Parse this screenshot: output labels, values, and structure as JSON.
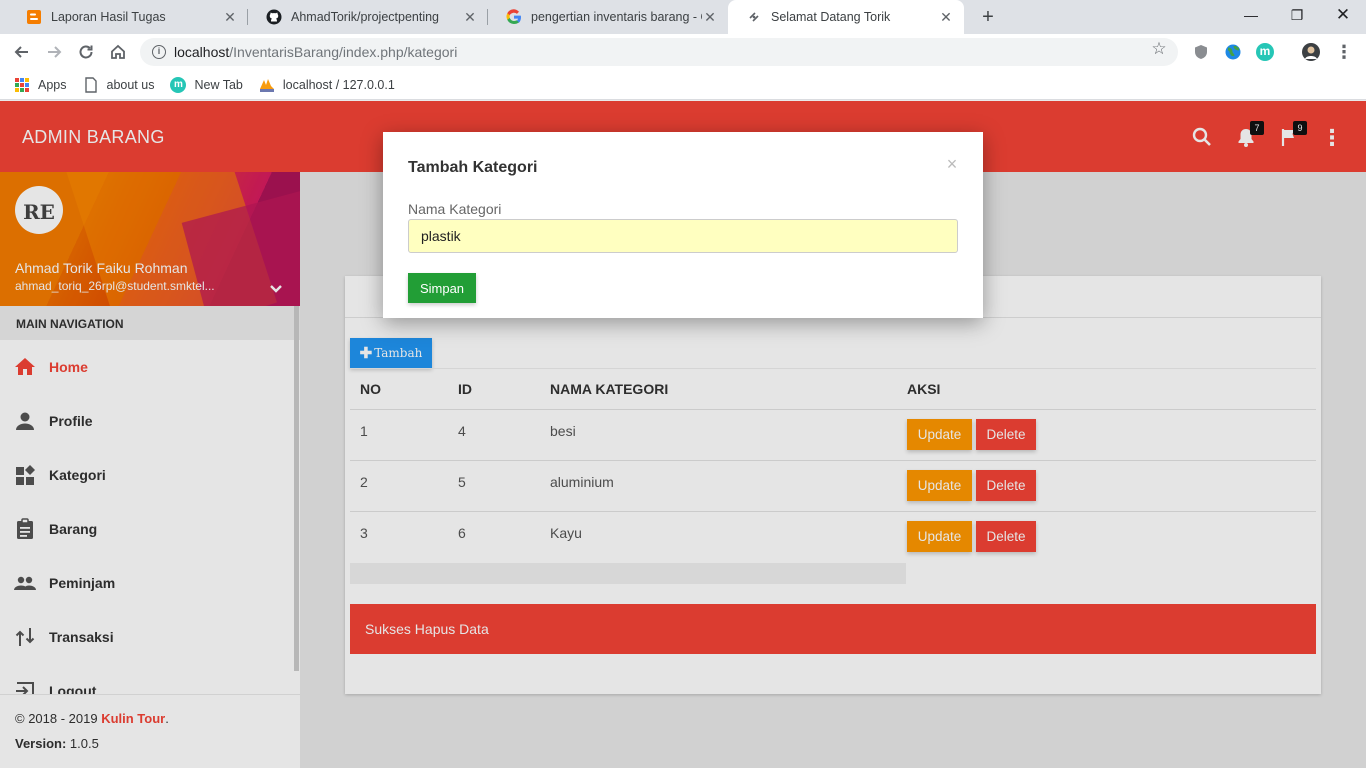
{
  "browser": {
    "tabs": [
      {
        "title": "Laporan Hasil Tugas",
        "icon": "blogger-icon"
      },
      {
        "title": "AhmadTorik/projectpenting",
        "icon": "github-icon"
      },
      {
        "title": "pengertian inventaris barang - Go",
        "icon": "google-icon"
      },
      {
        "title": "Selamat Datang Torik",
        "icon": "link-icon"
      }
    ],
    "new_tab": "+",
    "url_host": "localhost",
    "url_path": "/InventarisBarang/index.php/kategori",
    "bookmarks": [
      {
        "label": "Apps",
        "icon": "apps-icon"
      },
      {
        "label": "about us",
        "icon": "page-icon"
      },
      {
        "label": "New Tab",
        "icon": "m-icon"
      },
      {
        "label": "localhost / 127.0.0.1",
        "icon": "pma-icon"
      }
    ],
    "ext_m_letter": "m",
    "colors": {
      "tabbar": "#dee1e6",
      "omnibox": "#f1f3f4"
    }
  },
  "app": {
    "brand": "ADMIN BARANG",
    "notifications_count": "7",
    "flags_count": "9",
    "user": {
      "avatar_initials": "RE",
      "name": "Ahmad Torik Faiku Rohman",
      "email": "ahmad_toriq_26rpl@student.smktel..."
    },
    "nav_header": "MAIN NAVIGATION",
    "nav_items": [
      {
        "label": "Home",
        "icon": "home-icon",
        "active": true
      },
      {
        "label": "Profile",
        "icon": "person-icon"
      },
      {
        "label": "Kategori",
        "icon": "widgets-icon"
      },
      {
        "label": "Barang",
        "icon": "clipboard-icon"
      },
      {
        "label": "Peminjam",
        "icon": "people-icon"
      },
      {
        "label": "Transaksi",
        "icon": "swap-icon"
      },
      {
        "label": "Logout",
        "icon": "logout-icon"
      }
    ],
    "footer": {
      "copyright": "© 2018 - 2019 ",
      "brand": "Kulin Tour",
      "brand_suffix": ".",
      "version_label": "Version:",
      "version": " 1.0.5"
    },
    "colors": {
      "primary": "#f44336",
      "info": "#2196f3",
      "warning": "#ff9800",
      "success": "#229e36"
    }
  },
  "page": {
    "tambah_label": "Tambah",
    "table": {
      "headers": [
        "NO",
        "ID",
        "NAMA KATEGORI",
        "AKSI"
      ],
      "rows": [
        {
          "no": "1",
          "id": "4",
          "nama": "besi"
        },
        {
          "no": "2",
          "id": "5",
          "nama": "aluminium"
        },
        {
          "no": "3",
          "id": "6",
          "nama": "Kayu"
        }
      ],
      "update_label": "Update",
      "delete_label": "Delete"
    },
    "alert": "Sukses Hapus Data"
  },
  "modal": {
    "title": "Tambah Kategori",
    "close": "×",
    "field_label": "Nama Kategori",
    "field_value": "plastik",
    "submit_label": "Simpan"
  }
}
